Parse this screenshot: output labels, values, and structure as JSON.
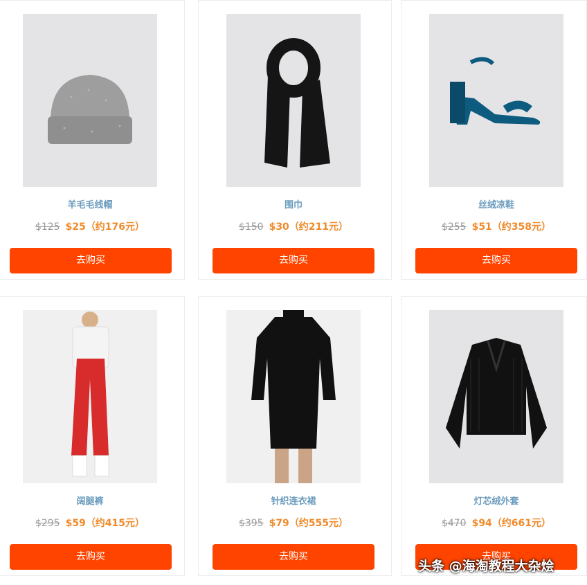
{
  "products": [
    {
      "name": "羊毛毛线帽",
      "old_price": "$125",
      "new_price": "$25",
      "rmb": "（约176元）",
      "button": "去购买",
      "image": "beanie-hat"
    },
    {
      "name": "围巾",
      "old_price": "$150",
      "new_price": "$30",
      "rmb": "（约211元）",
      "button": "去购买",
      "image": "black-scarf"
    },
    {
      "name": "丝绒凉鞋",
      "old_price": "$255",
      "new_price": "$51",
      "rmb": "（约358元）",
      "button": "去购买",
      "image": "velvet-sandal"
    },
    {
      "name": "阔腿裤",
      "old_price": "$295",
      "new_price": "$59",
      "rmb": "（约415元）",
      "button": "去购买",
      "image": "red-wide-pants"
    },
    {
      "name": "针织连衣裙",
      "old_price": "$395",
      "new_price": "$79",
      "rmb": "（约555元）",
      "button": "去购买",
      "image": "black-knit-dress"
    },
    {
      "name": "灯芯绒外套",
      "old_price": "$470",
      "new_price": "$94",
      "rmb": "（约661元）",
      "button": "去购买",
      "image": "corduroy-jacket"
    }
  ],
  "watermark": {
    "text": "头条 @海淘教程大杂烩"
  },
  "colors": {
    "accent": "#ff4400",
    "price": "#f08a2a",
    "name": "#6a9bbd",
    "old_price": "#9a9a9a"
  }
}
